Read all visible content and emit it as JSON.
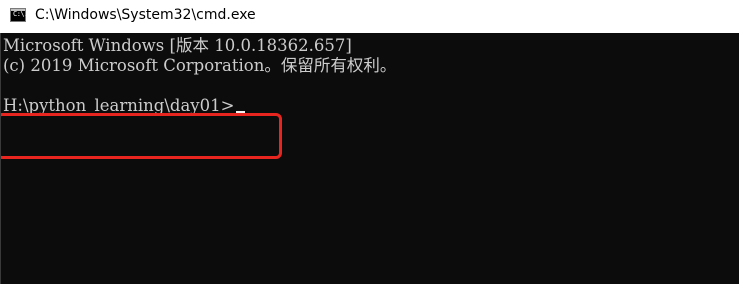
{
  "window": {
    "title": "C:\\Windows\\System32\\cmd.exe",
    "icon": "cmd-icon",
    "icon_text": "C:\\."
  },
  "console": {
    "lines": [
      "Microsoft Windows [版本 10.0.18362.657]",
      "(c) 2019 Microsoft Corporation。保留所有权利。",
      "",
      "H:\\python_learning\\day01>"
    ],
    "cursor": "_"
  },
  "colors": {
    "console_background": "#0c0c0c",
    "console_text": "#cccccc",
    "highlight": "#e8261f",
    "titlebar_background": "#ffffff"
  }
}
